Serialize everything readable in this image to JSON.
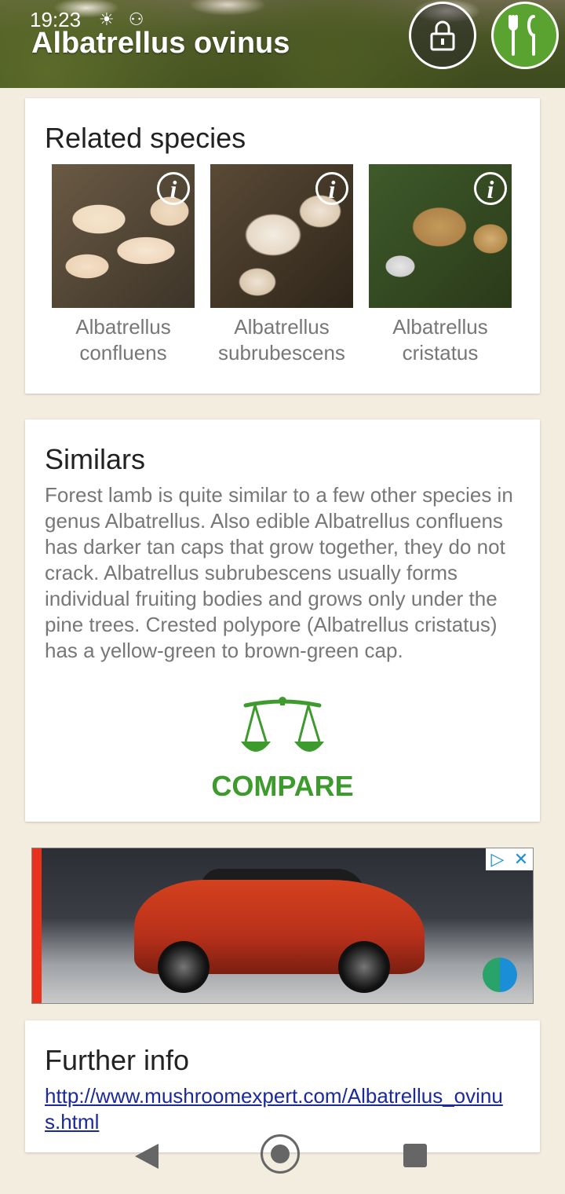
{
  "status": {
    "time": "19:23"
  },
  "header": {
    "title": "Albatrellus ovinus"
  },
  "related": {
    "heading": "Related species",
    "items": [
      {
        "name_line1": "Albatrellus",
        "name_line2": "confluens"
      },
      {
        "name_line1": "Albatrellus",
        "name_line2": "subrubescens"
      },
      {
        "name_line1": "Albatrellus",
        "name_line2": "cristatus"
      }
    ]
  },
  "similars": {
    "heading": "Similars",
    "text": "Forest lamb is quite similar to a few other species in genus Albatrellus. Also edible Albatrellus confluens has darker tan caps that grow together, they do not crack. Albatrellus subrubescens usually forms individual fruiting bodies and grows only under the pine trees. Crested polypore (Albatrellus cristatus) has a yellow-green to brown-green cap.",
    "compare_label": "COMPARE"
  },
  "further": {
    "heading": "Further info",
    "link": "http://www.mushroomexpert.com/Albatrellus_ovinus.html"
  },
  "colors": {
    "accent_green": "#3d9a2d",
    "background": "#f3ede0",
    "link": "#1a2a9a"
  }
}
